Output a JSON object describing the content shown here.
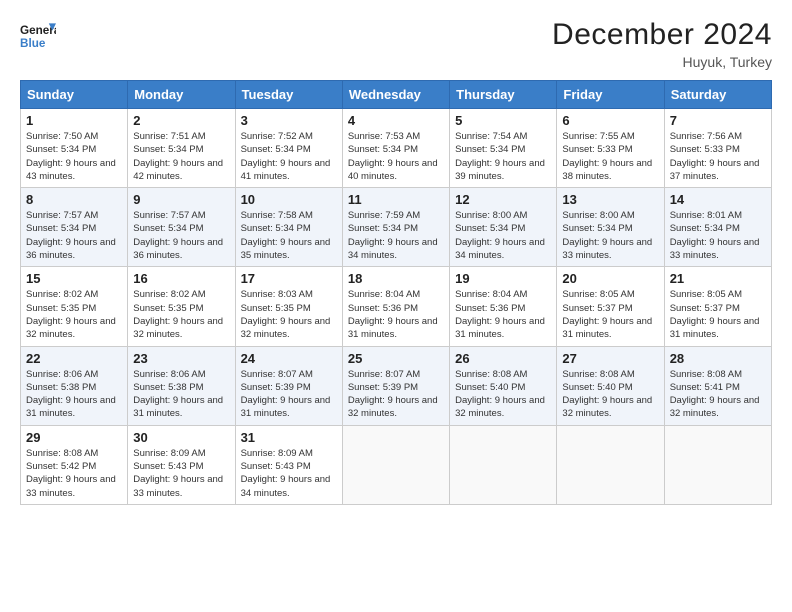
{
  "logo": {
    "line1": "General",
    "line2": "Blue"
  },
  "title": "December 2024",
  "subtitle": "Huyuk, Turkey",
  "days_of_week": [
    "Sunday",
    "Monday",
    "Tuesday",
    "Wednesday",
    "Thursday",
    "Friday",
    "Saturday"
  ],
  "weeks": [
    [
      {
        "day": "1",
        "sunrise": "7:50 AM",
        "sunset": "5:34 PM",
        "daylight": "9 hours and 43 minutes."
      },
      {
        "day": "2",
        "sunrise": "7:51 AM",
        "sunset": "5:34 PM",
        "daylight": "9 hours and 42 minutes."
      },
      {
        "day": "3",
        "sunrise": "7:52 AM",
        "sunset": "5:34 PM",
        "daylight": "9 hours and 41 minutes."
      },
      {
        "day": "4",
        "sunrise": "7:53 AM",
        "sunset": "5:34 PM",
        "daylight": "9 hours and 40 minutes."
      },
      {
        "day": "5",
        "sunrise": "7:54 AM",
        "sunset": "5:34 PM",
        "daylight": "9 hours and 39 minutes."
      },
      {
        "day": "6",
        "sunrise": "7:55 AM",
        "sunset": "5:33 PM",
        "daylight": "9 hours and 38 minutes."
      },
      {
        "day": "7",
        "sunrise": "7:56 AM",
        "sunset": "5:33 PM",
        "daylight": "9 hours and 37 minutes."
      }
    ],
    [
      {
        "day": "8",
        "sunrise": "7:57 AM",
        "sunset": "5:34 PM",
        "daylight": "9 hours and 36 minutes."
      },
      {
        "day": "9",
        "sunrise": "7:57 AM",
        "sunset": "5:34 PM",
        "daylight": "9 hours and 36 minutes."
      },
      {
        "day": "10",
        "sunrise": "7:58 AM",
        "sunset": "5:34 PM",
        "daylight": "9 hours and 35 minutes."
      },
      {
        "day": "11",
        "sunrise": "7:59 AM",
        "sunset": "5:34 PM",
        "daylight": "9 hours and 34 minutes."
      },
      {
        "day": "12",
        "sunrise": "8:00 AM",
        "sunset": "5:34 PM",
        "daylight": "9 hours and 34 minutes."
      },
      {
        "day": "13",
        "sunrise": "8:00 AM",
        "sunset": "5:34 PM",
        "daylight": "9 hours and 33 minutes."
      },
      {
        "day": "14",
        "sunrise": "8:01 AM",
        "sunset": "5:34 PM",
        "daylight": "9 hours and 33 minutes."
      }
    ],
    [
      {
        "day": "15",
        "sunrise": "8:02 AM",
        "sunset": "5:35 PM",
        "daylight": "9 hours and 32 minutes."
      },
      {
        "day": "16",
        "sunrise": "8:02 AM",
        "sunset": "5:35 PM",
        "daylight": "9 hours and 32 minutes."
      },
      {
        "day": "17",
        "sunrise": "8:03 AM",
        "sunset": "5:35 PM",
        "daylight": "9 hours and 32 minutes."
      },
      {
        "day": "18",
        "sunrise": "8:04 AM",
        "sunset": "5:36 PM",
        "daylight": "9 hours and 31 minutes."
      },
      {
        "day": "19",
        "sunrise": "8:04 AM",
        "sunset": "5:36 PM",
        "daylight": "9 hours and 31 minutes."
      },
      {
        "day": "20",
        "sunrise": "8:05 AM",
        "sunset": "5:37 PM",
        "daylight": "9 hours and 31 minutes."
      },
      {
        "day": "21",
        "sunrise": "8:05 AM",
        "sunset": "5:37 PM",
        "daylight": "9 hours and 31 minutes."
      }
    ],
    [
      {
        "day": "22",
        "sunrise": "8:06 AM",
        "sunset": "5:38 PM",
        "daylight": "9 hours and 31 minutes."
      },
      {
        "day": "23",
        "sunrise": "8:06 AM",
        "sunset": "5:38 PM",
        "daylight": "9 hours and 31 minutes."
      },
      {
        "day": "24",
        "sunrise": "8:07 AM",
        "sunset": "5:39 PM",
        "daylight": "9 hours and 31 minutes."
      },
      {
        "day": "25",
        "sunrise": "8:07 AM",
        "sunset": "5:39 PM",
        "daylight": "9 hours and 32 minutes."
      },
      {
        "day": "26",
        "sunrise": "8:08 AM",
        "sunset": "5:40 PM",
        "daylight": "9 hours and 32 minutes."
      },
      {
        "day": "27",
        "sunrise": "8:08 AM",
        "sunset": "5:40 PM",
        "daylight": "9 hours and 32 minutes."
      },
      {
        "day": "28",
        "sunrise": "8:08 AM",
        "sunset": "5:41 PM",
        "daylight": "9 hours and 32 minutes."
      }
    ],
    [
      {
        "day": "29",
        "sunrise": "8:08 AM",
        "sunset": "5:42 PM",
        "daylight": "9 hours and 33 minutes."
      },
      {
        "day": "30",
        "sunrise": "8:09 AM",
        "sunset": "5:43 PM",
        "daylight": "9 hours and 33 minutes."
      },
      {
        "day": "31",
        "sunrise": "8:09 AM",
        "sunset": "5:43 PM",
        "daylight": "9 hours and 34 minutes."
      },
      null,
      null,
      null,
      null
    ]
  ],
  "labels": {
    "sunrise": "Sunrise:",
    "sunset": "Sunset:",
    "daylight": "Daylight:"
  }
}
